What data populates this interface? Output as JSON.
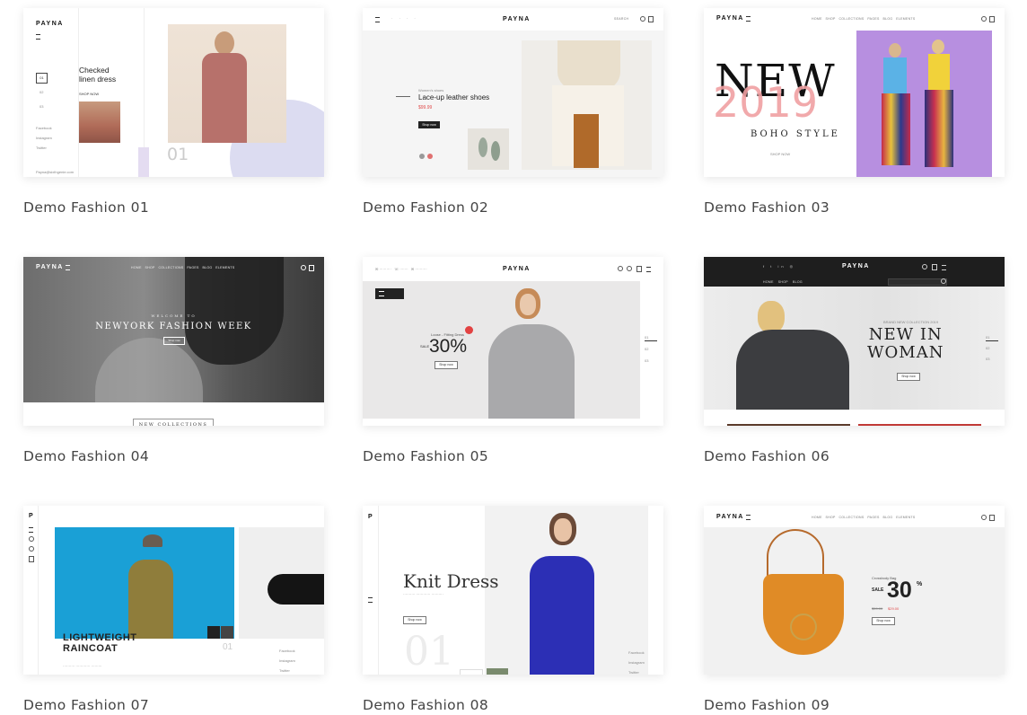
{
  "demos": [
    {
      "caption": "Demo Fashion 01"
    },
    {
      "caption": "Demo Fashion 02"
    },
    {
      "caption": "Demo Fashion 03"
    },
    {
      "caption": "Demo Fashion 04"
    },
    {
      "caption": "Demo Fashion 05"
    },
    {
      "caption": "Demo Fashion 06"
    },
    {
      "caption": "Demo Fashion 07"
    },
    {
      "caption": "Demo Fashion 08"
    },
    {
      "caption": "Demo Fashion 09"
    }
  ],
  "d1": {
    "logo": "PAYNA",
    "title_line1": "Checked",
    "title_line2": "linen dress",
    "shop": "SHOP NOW",
    "n1": "01",
    "n2": "02",
    "n3": "03",
    "s1": "Facebook",
    "s2": "Instagram",
    "s3": "Twitter",
    "big_num": "01",
    "footer": "Payna@sixthgenie.com"
  },
  "d2": {
    "logo": "PAYNA",
    "kicker": "Women's shoes",
    "title": "Lace-up leather shoes",
    "price": "$99.99",
    "btn": "Shop now",
    "search": "SEARCH"
  },
  "d3": {
    "logo": "PAYNA",
    "new": "NEW",
    "year": "2019",
    "boho": "BOHO STYLE",
    "shop": "SHOP NOW"
  },
  "d4": {
    "logo": "PAYNA",
    "welcome": "WELCOME TO",
    "headline": "NEWYORK FASHION WEEK",
    "btn": "Shop now",
    "collections": "NEW COLLECTIONS"
  },
  "d5": {
    "logo": "PAYNA",
    "kicker": "Loose - Fitting Dress",
    "sale": "SALE",
    "pct": "30%",
    "btn": "Shop now",
    "n1": "01",
    "n2": "02",
    "n3": "03"
  },
  "d6": {
    "logo": "PAYNA",
    "kicker": "BRAND NEW COLLECTION 2019",
    "line1": "NEW IN",
    "line2": "WOMAN",
    "btn": "Shop now",
    "n1": "01",
    "n2": "02",
    "n3": "03"
  },
  "d7": {
    "logo": "P",
    "line1": "LIGHTWEIGHT",
    "line2": "RAINCOAT",
    "num": "01",
    "s1": "Facebook",
    "s2": "Instagram",
    "s3": "Twitter"
  },
  "d8": {
    "logo": "P",
    "title": "Knit Dress",
    "btn": "Shop now",
    "big": "01",
    "s1": "Facebook",
    "s2": "Instagram",
    "s3": "Twitter"
  },
  "d9": {
    "logo": "PAYNA",
    "kicker": "Crossbody Bag",
    "sale": "SALE",
    "pct": "30",
    "pctsym": "%",
    "old": "$59.00",
    "new": "$29.00",
    "btn": "Shop now"
  },
  "nav": [
    "HOME",
    "SHOP",
    "COLLECTIONS",
    "PAGES",
    "BLOG",
    "ELEMENTS"
  ]
}
